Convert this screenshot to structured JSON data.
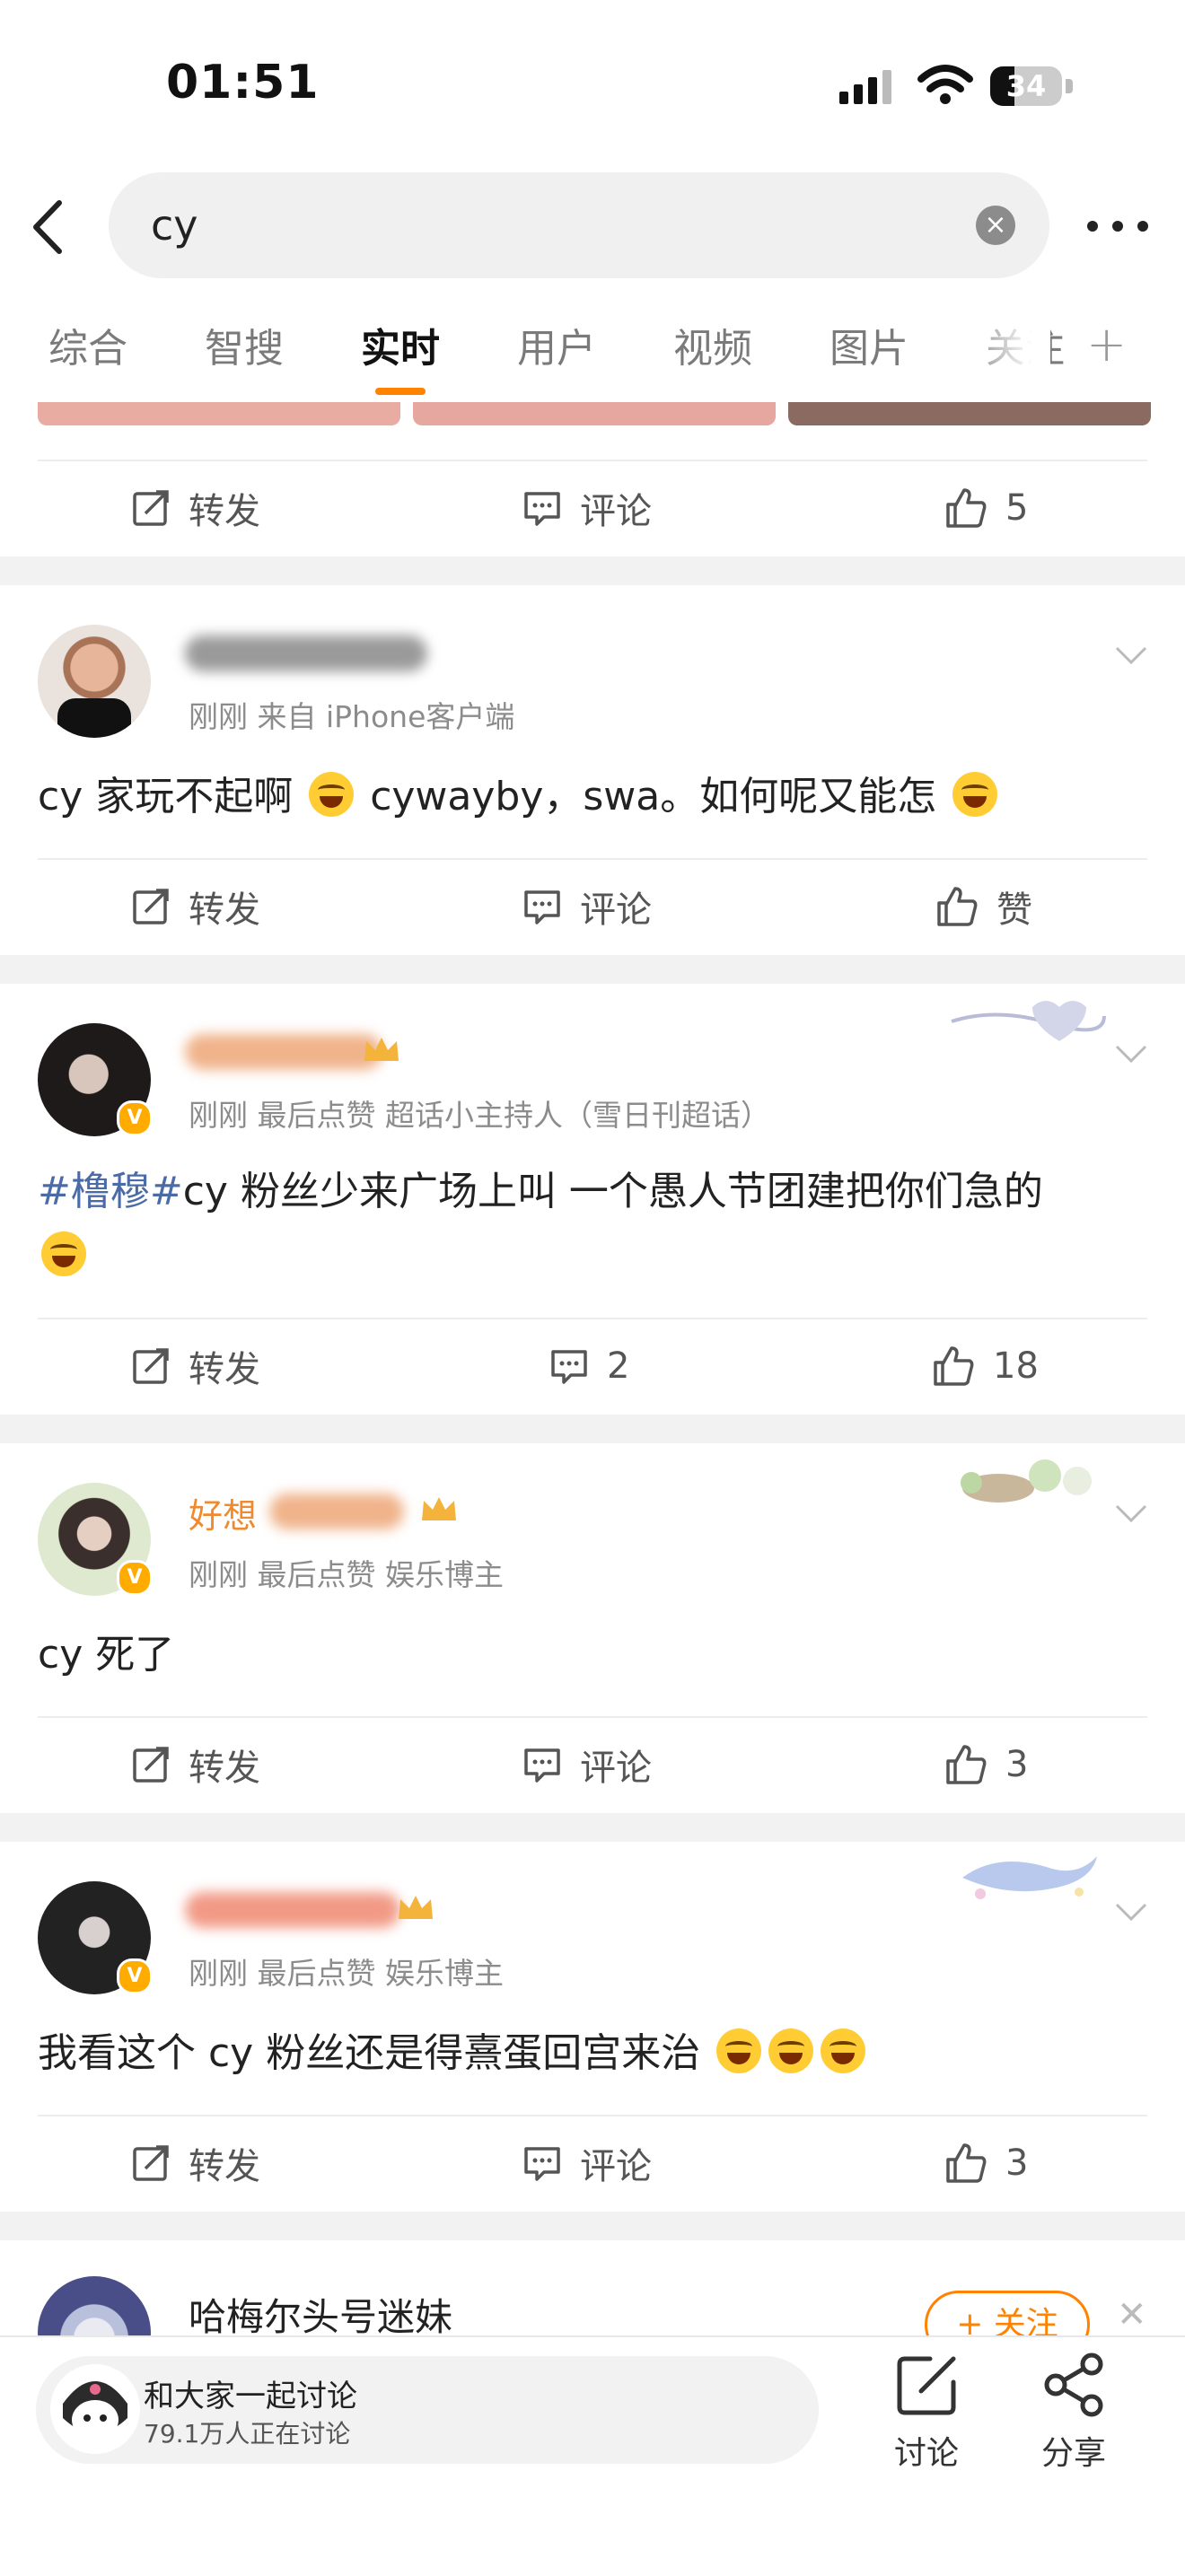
{
  "status_bar": {
    "time": "01:51",
    "battery": "34",
    "battery_level": 0.34
  },
  "search": {
    "query": "cy",
    "clear_glyph": "×"
  },
  "tabs": [
    {
      "label": "综合",
      "active": false
    },
    {
      "label": "智搜",
      "active": false
    },
    {
      "label": "实时",
      "active": true
    },
    {
      "label": "用户",
      "active": false
    },
    {
      "label": "视频",
      "active": false
    },
    {
      "label": "图片",
      "active": false
    },
    {
      "label": "关注",
      "active": false
    }
  ],
  "tab_add": "+",
  "posts": [
    {
      "repost_label": "转发",
      "comment_label": "评论",
      "like_label": "5"
    },
    {
      "author": "",
      "meta": "刚刚  来自 iPhone客户端",
      "text_after": "cy 家玩不起啊 ",
      "text_mid": " cywayby，swa。如何呢又能怎 ",
      "repost_label": "转发",
      "comment_label": "评论",
      "like_label": "赞"
    },
    {
      "author": "",
      "meta": "刚刚  最后点赞  超话小主持人（雪日刊超话）",
      "topic": "#橹穆#",
      "text": "cy 粉丝少来广场上叫 一个愚人节团建把你们急的",
      "repost_label": "转发",
      "comment_label": "2",
      "like_label": "18"
    },
    {
      "author": "好想",
      "meta": "刚刚  最后点赞  娱乐博主",
      "text": "cy 死了",
      "repost_label": "转发",
      "comment_label": "评论",
      "like_label": "3"
    },
    {
      "author": "",
      "meta": "刚刚  最后点赞  娱乐博主",
      "text": "我看这个 cy 粉丝还是得熹蛋回宫来治 ",
      "repost_label": "转发",
      "comment_label": "评论",
      "like_label": "3"
    },
    {
      "author": "哈梅尔头号迷妹_",
      "follow_label": "+ 关注"
    }
  ],
  "bottom_bar": {
    "discuss_title": "和大家一起讨论",
    "discuss_sub": "79.1万人正在讨论",
    "discuss_label": "讨论",
    "share_label": "分享"
  },
  "colors": {
    "accent": "#ff8200",
    "topic": "#4a6aa8",
    "vip": "#ffab00"
  }
}
